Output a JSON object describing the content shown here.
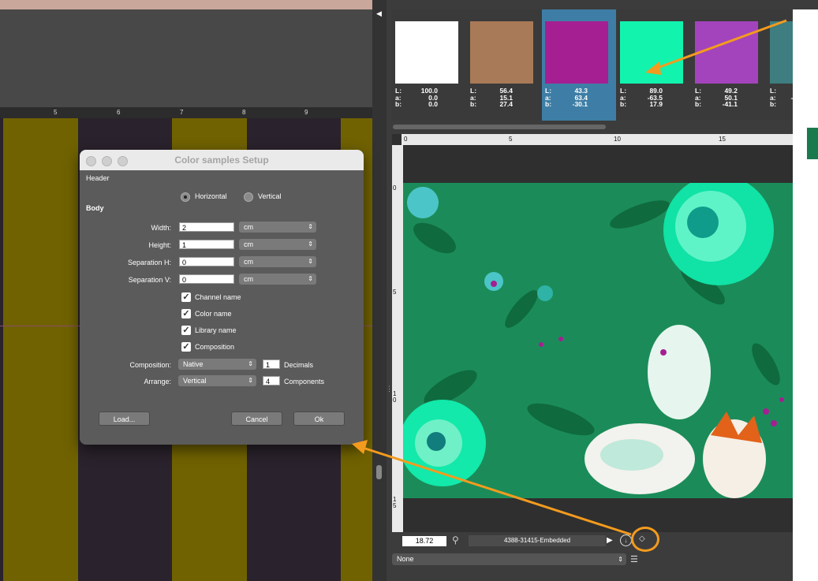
{
  "workspace": {
    "ruler_ticks": [
      "5",
      "6",
      "7",
      "8",
      "9"
    ]
  },
  "swatches": [
    {
      "color": "#ffffff",
      "L": "100.0",
      "a": "0.0",
      "b": "0.0",
      "selected": false
    },
    {
      "color": "#a87a58",
      "L": "56.4",
      "a": "15.1",
      "b": "27.4",
      "selected": false
    },
    {
      "color": "#a51f93",
      "L": "43.3",
      "a": "63.4",
      "b": "-30.1",
      "selected": true
    },
    {
      "color": "#12f4ae",
      "L": "89.0",
      "a": "-63.5",
      "b": "17.9",
      "selected": false
    },
    {
      "color": "#a344bc",
      "L": "49.2",
      "a": "50.1",
      "b": "-41.1",
      "selected": false
    },
    {
      "color": "#3e7d80",
      "L": "4",
      "a": "-1",
      "b": "-",
      "selected": false
    }
  ],
  "lab_keys": {
    "L": "L:",
    "a": "a:",
    "b": "b:"
  },
  "preview": {
    "ruler_h": [
      "0",
      "5",
      "10",
      "15"
    ],
    "ruler_v": [
      "0",
      "5",
      "1\n0",
      "1\n5"
    ],
    "zoom": "18.72",
    "file_name": "4388-31415-Embedded",
    "profile": "None"
  },
  "dialog": {
    "title": "Color samples Setup",
    "header_label": "Header",
    "orientation": {
      "horizontal": "Horizontal",
      "vertical": "Vertical",
      "selected": "horizontal"
    },
    "body_label": "Body",
    "width": {
      "label": "Width:",
      "value": "2",
      "unit": "cm"
    },
    "height": {
      "label": "Height:",
      "value": "1",
      "unit": "cm"
    },
    "sep_h": {
      "label": "Separation H:",
      "value": "0",
      "unit": "cm"
    },
    "sep_v": {
      "label": "Separation V:",
      "value": "0",
      "unit": "cm"
    },
    "checks": [
      {
        "label": "Channel name",
        "checked": true
      },
      {
        "label": "Color name",
        "checked": true
      },
      {
        "label": "Library name",
        "checked": true
      },
      {
        "label": "Composition",
        "checked": true
      }
    ],
    "composition": {
      "label": "Composition:",
      "value": "Native",
      "decimals": "1",
      "decimals_label": "Decimals"
    },
    "arrange": {
      "label": "Arrange:",
      "value": "Vertical",
      "components": "4",
      "components_label": "Components"
    },
    "load_button": "Load...",
    "cancel_button": "Cancel",
    "ok_button": "Ok"
  },
  "colors": {
    "annotation": "#f39b1e",
    "selection": "#3e7ea6",
    "stripe": "#706200",
    "artwork": "#1b8c59"
  }
}
